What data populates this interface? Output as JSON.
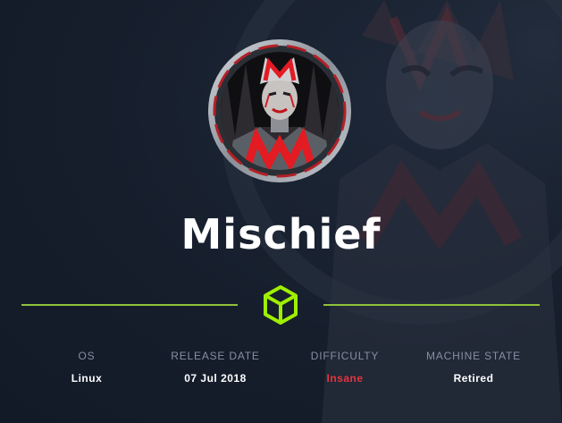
{
  "machine": {
    "name": "Mischief"
  },
  "stats": [
    {
      "label": "OS",
      "value": "Linux"
    },
    {
      "label": "RELEASE DATE",
      "value": "07 Jul 2018"
    },
    {
      "label": "DIFFICULTY",
      "value": "Insane"
    },
    {
      "label": "MACHINE STATE",
      "value": "Retired"
    }
  ],
  "colors": {
    "background": "#151d2b",
    "accent_green": "#8fc23a",
    "difficulty_insane": "#e8353e",
    "label_grey": "#8590a3",
    "text_white": "#ffffff"
  },
  "icons": {
    "avatar": "jester-avatar",
    "cube": "cube-icon"
  }
}
